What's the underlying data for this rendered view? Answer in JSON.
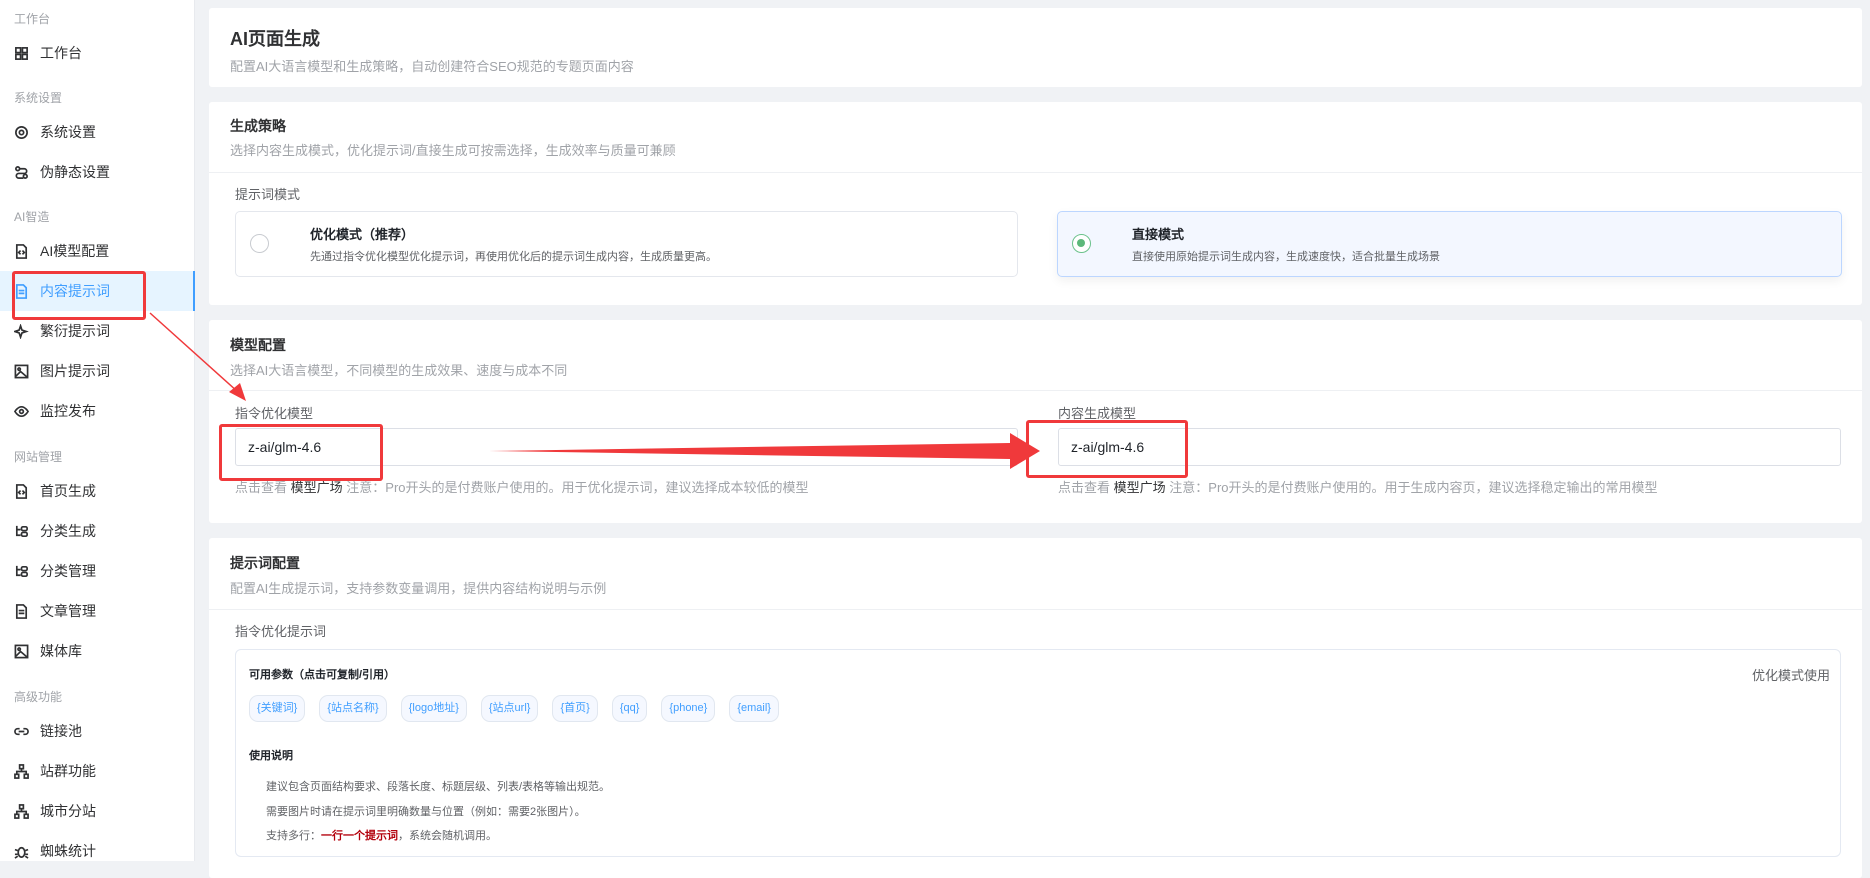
{
  "sidebar": {
    "sections": [
      {
        "label": "工作台",
        "items": [
          {
            "label": "工作台",
            "icon": "grid-icon"
          }
        ]
      },
      {
        "label": "系统设置",
        "items": [
          {
            "label": "系统设置",
            "icon": "gear-icon"
          },
          {
            "label": "伪静态设置",
            "icon": "route-icon"
          }
        ]
      },
      {
        "label": "AI智造",
        "items": [
          {
            "label": "AI模型配置",
            "icon": "code-file-icon"
          },
          {
            "label": "内容提示词",
            "icon": "document-icon",
            "active": true
          },
          {
            "label": "繁衍提示词",
            "icon": "sparkle-icon"
          },
          {
            "label": "图片提示词",
            "icon": "image-icon"
          },
          {
            "label": "监控发布",
            "icon": "eye-icon"
          }
        ]
      },
      {
        "label": "网站管理",
        "items": [
          {
            "label": "首页生成",
            "icon": "code-file-icon"
          },
          {
            "label": "分类生成",
            "icon": "tree-icon"
          },
          {
            "label": "分类管理",
            "icon": "tree-icon"
          },
          {
            "label": "文章管理",
            "icon": "document-icon"
          },
          {
            "label": "媒体库",
            "icon": "image-icon"
          }
        ]
      },
      {
        "label": "高级功能",
        "items": [
          {
            "label": "链接池",
            "icon": "link-icon"
          },
          {
            "label": "站群功能",
            "icon": "network-icon"
          },
          {
            "label": "城市分站",
            "icon": "network-icon"
          },
          {
            "label": "蜘蛛统计",
            "icon": "bug-icon"
          }
        ]
      }
    ]
  },
  "header": {
    "title": "AI页面生成",
    "subtitle": "配置AI大语言模型和生成策略，自动创建符合SEO规范的专题页面内容"
  },
  "strategy": {
    "title": "生成策略",
    "desc": "选择内容生成模式，优化提示词/直接生成可按需选择，生成效率与质量可兼顾",
    "mode_label": "提示词模式",
    "options": [
      {
        "title": "优化模式（推荐）",
        "desc": "先通过指令优化模型优化提示词，再使用优化后的提示词生成内容，生成质量更高。",
        "selected": false
      },
      {
        "title": "直接模式",
        "desc": "直接使用原始提示词生成内容，生成速度快，适合批量生成场景",
        "selected": true
      }
    ]
  },
  "model": {
    "title": "模型配置",
    "desc": "选择AI大语言模型，不同模型的生成效果、速度与成本不同",
    "optimize": {
      "label": "指令优化模型",
      "value": "z-ai/glm-4.6",
      "hint_prefix": "点击查看",
      "hint_link": "模型广场",
      "hint": "注意：Pro开头的是付费账户使用的。用于优化提示词，建议选择成本较低的模型"
    },
    "content": {
      "label": "内容生成模型",
      "value": "z-ai/glm-4.6",
      "hint_prefix": "点击查看",
      "hint_link": "模型广场",
      "hint": "注意：Pro开头的是付费账户使用的。用于生成内容页，建议选择稳定输出的常用模型"
    }
  },
  "prompt": {
    "title": "提示词配置",
    "desc": "配置AI生成提示词，支持参数变量调用，提供内容结构说明与示例",
    "label": "指令优化提示词",
    "params_title": "可用参数（点击可复制/引用）",
    "usage_tag": "优化模式使用",
    "params": [
      "{关键词}",
      "{站点名称}",
      "{logo地址}",
      "{站点url}",
      "{首页}",
      "{qq}",
      "{phone}",
      "{email}"
    ],
    "usage_title": "使用说明",
    "lines": [
      "建议包含页面结构要求、段落长度、标题层级、列表/表格等输出规范。",
      "需要图片时请在提示词里明确数量与位置（例如：需要2张图片）。"
    ],
    "line3_prefix": "支持多行：",
    "line3_em": "一行一个提示词",
    "line3_suffix": "，系统会随机调用。"
  },
  "colors": {
    "accent": "#409eff",
    "selected_radio": "#5cb87a",
    "annotation": "#f0393b"
  }
}
